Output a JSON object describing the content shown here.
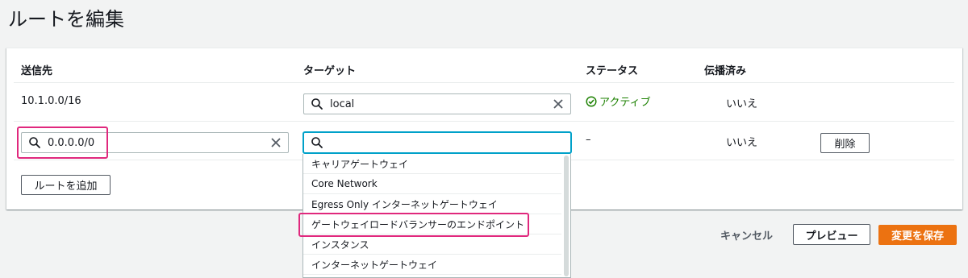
{
  "page": {
    "title": "ルートを編集"
  },
  "table": {
    "headers": {
      "destination": "送信先",
      "target": "ターゲット",
      "status": "ステータス",
      "propagated": "伝播済み"
    },
    "rows": [
      {
        "destination": "10.1.0.0/16",
        "target_value": "local",
        "status": "アクティブ",
        "propagated": "いいえ"
      },
      {
        "destination_value": "0.0.0.0/0",
        "target_value": "",
        "status": "–",
        "propagated": "いいえ",
        "remove_label": "削除"
      }
    ],
    "add_route_label": "ルートを追加"
  },
  "dropdown": {
    "options": [
      "キャリアゲートウェイ",
      "Core Network",
      "Egress Only インターネットゲートウェイ",
      "ゲートウェイロードバランサーのエンドポイント",
      "インスタンス",
      "インターネットゲートウェイ"
    ]
  },
  "footer": {
    "cancel_label": "キャンセル",
    "preview_label": "プレビュー",
    "save_label": "変更を保存"
  },
  "colors": {
    "accent": "#ec7211",
    "focus": "#00a1c9",
    "highlight": "#e0287d",
    "success": "#1d8102"
  }
}
